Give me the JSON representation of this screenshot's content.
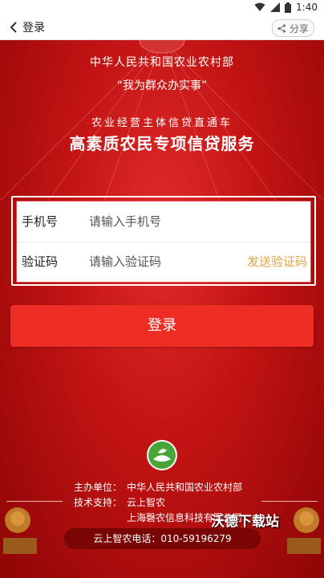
{
  "status_bar": {
    "time": "1:40"
  },
  "nav": {
    "back_label": "登录",
    "share_label": "分享"
  },
  "hero": {
    "ministry": "中华人民共和国农业农村部",
    "slogan": "“我为群众办实事”",
    "subtitle": "农业经营主体信贷直通车",
    "title": "高素质农民专项信贷服务"
  },
  "form": {
    "phone_label": "手机号",
    "phone_placeholder": "请输入手机号",
    "code_label": "验证码",
    "code_placeholder": "请输入验证码",
    "send_code_label": "发送验证码"
  },
  "login_button": "登录",
  "credits": {
    "host_label": "主办单位：",
    "host_value": "中华人民共和国农业农村部",
    "tech_label": "技术支持：",
    "tech_value_1": "云上智农",
    "tech_value_2": "上海磬农信息科技有限公司"
  },
  "phone_text": "云上智农电话：010-59196279",
  "watermark": "沃德下载站",
  "colors": {
    "primary_red": "#ee2e24",
    "send_code": "#e0a64a",
    "bg_red": "#b80d0d"
  }
}
